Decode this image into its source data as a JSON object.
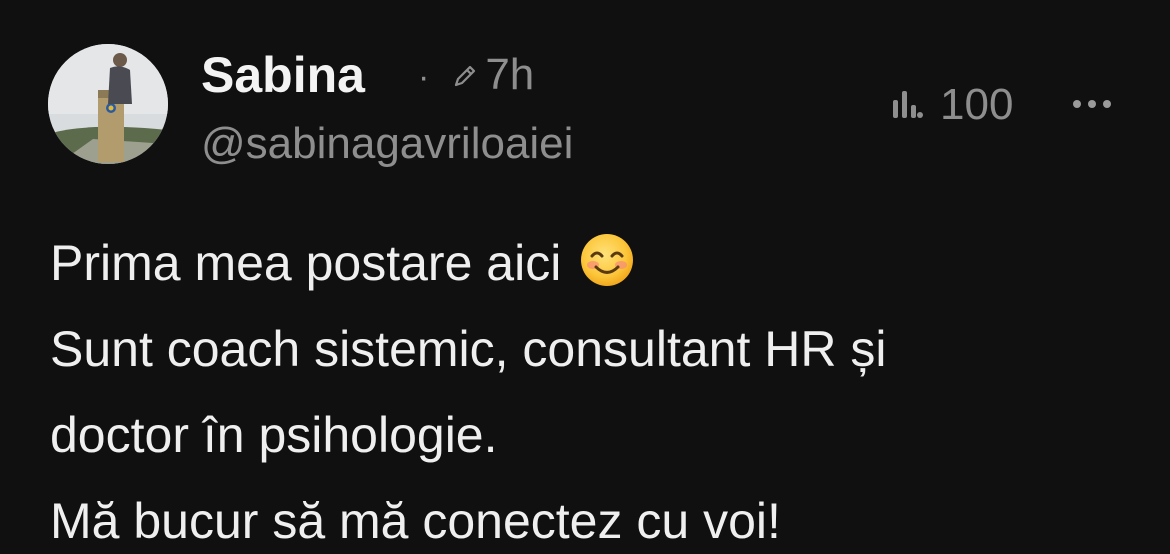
{
  "post": {
    "author": {
      "display_name": "Sabina",
      "handle": "@sabinagavriloaiei",
      "avatar_icon": "avatar-photo"
    },
    "meta": {
      "separator": "·",
      "edited_icon": "pencil-icon",
      "timestamp": "7h"
    },
    "stats": {
      "views_icon": "bar-chart-icon",
      "views_count": "100",
      "more_icon": "more-horizontal-icon"
    },
    "body": {
      "lines": [
        "Prima mea postare aici",
        "Sunt coach sistemic, consultant HR și",
        "doctor în psihologie.",
        "Mă bucur să mă conectez cu voi!"
      ],
      "emoji": "smiling-face-with-smiling-eyes"
    }
  },
  "colors": {
    "background": "#101010",
    "primary_text": "#ececec",
    "secondary_text": "#8e8e8e"
  }
}
